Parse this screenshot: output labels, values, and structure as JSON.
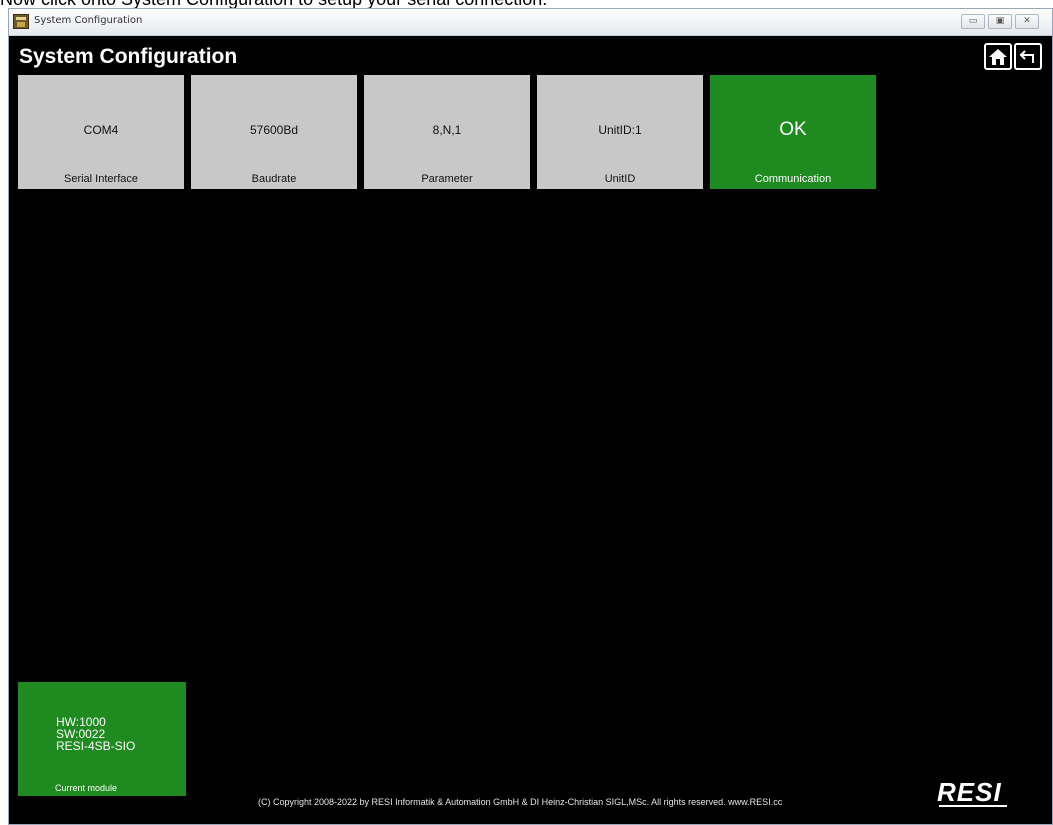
{
  "instruction": "Now click onto System Configuration to setup your serial connection.",
  "window": {
    "title": "System Configuration",
    "controls": {
      "minimize": "▭",
      "maximize": "▣",
      "close": "✕"
    }
  },
  "app": {
    "title": "System Configuration",
    "nav": {
      "home_icon": "home-icon",
      "back_icon": "back-arrow-icon"
    }
  },
  "tiles": [
    {
      "value": "COM4",
      "label": "Serial Interface"
    },
    {
      "value": "57600Bd",
      "label": "Baudrate"
    },
    {
      "value": "8,N,1",
      "label": "Parameter"
    },
    {
      "value": "UnitID:1",
      "label": "UnitID"
    },
    {
      "value": "OK",
      "label": "Communication"
    }
  ],
  "module": {
    "hw": "HW:1000",
    "sw": "SW:0022",
    "name": "RESI-4SB-SIO",
    "label": "Current module"
  },
  "footer": {
    "copyright": "(C) Copyright 2008-2022 by RESI Informatik & Automation GmbH & DI Heinz-Christian SIGL,MSc. All rights reserved. www.RESI.cc",
    "logo": "RESI"
  },
  "colors": {
    "background": "#000000",
    "tile_gray": "#c8c8c8",
    "accent_green": "#1f8a1f"
  }
}
